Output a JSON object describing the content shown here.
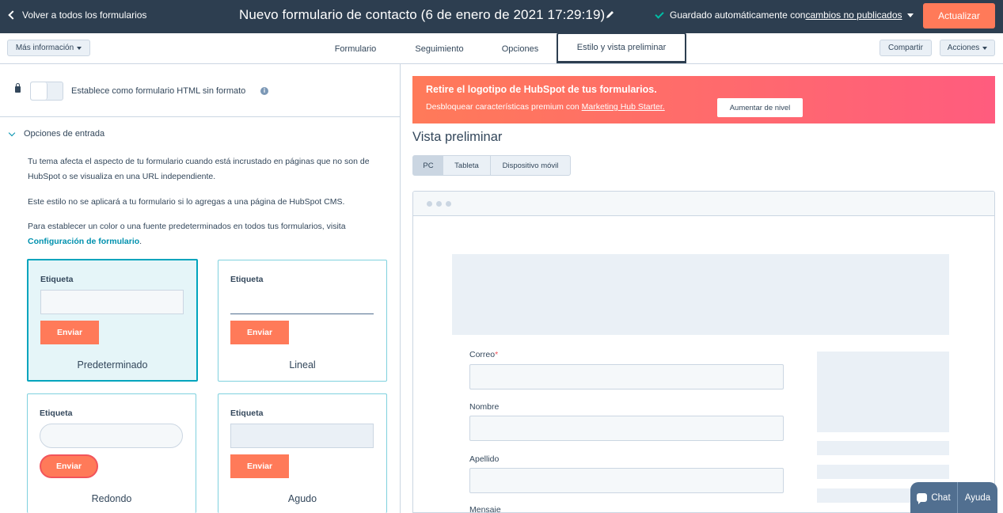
{
  "topbar": {
    "back_label": "Volver a todos los formularios",
    "form_title": "Nuevo formulario de contacto (6 de enero de 2021 17:29:19)",
    "saved_text": "Guardado automáticamente con",
    "saved_link": "cambios no publicados",
    "update_button": "Actualizar"
  },
  "tabbar": {
    "more_info": "Más información",
    "tabs": [
      {
        "label": "Formulario"
      },
      {
        "label": "Seguimiento"
      },
      {
        "label": "Opciones"
      },
      {
        "label": "Estilo y vista preliminar",
        "active": true
      }
    ],
    "share": "Compartir",
    "actions": "Acciones"
  },
  "left": {
    "raw_html_label": "Establece como formulario HTML sin formato",
    "section_title": "Opciones de entrada",
    "para1": "Tu tema afecta el aspecto de tu formulario cuando está incrustado en páginas que no son de HubSpot o se visualiza en una URL independiente.",
    "para2": "Este estilo no se aplicará a tu formulario si lo agregas a una página de HubSpot CMS.",
    "para3": "Para establecer un color o una fuente predeterminados en todos tus formularios, visita",
    "para3_link": "Configuración de formulario",
    "para3_end": ".",
    "styles": [
      {
        "field_label": "Etiqueta",
        "button": "Enviar",
        "name": "Predeterminado",
        "selected": true
      },
      {
        "field_label": "Etiqueta",
        "button": "Enviar",
        "name": "Lineal"
      },
      {
        "field_label": "Etiqueta",
        "button": "Enviar",
        "name": "Redondo"
      },
      {
        "field_label": "Etiqueta",
        "button": "Enviar",
        "name": "Agudo"
      }
    ]
  },
  "right": {
    "banner_title": "Retire el logotipo de HubSpot de tus formularios.",
    "banner_text": "Desbloquear características premium con",
    "banner_link": "Marketing Hub Starter.",
    "banner_button": "Aumentar de nivel",
    "preview_title": "Vista preliminar",
    "devices": [
      "PC",
      "Tableta",
      "Dispositivo móvil"
    ],
    "active_device": "PC",
    "fields": [
      {
        "label": "Correo",
        "required": "*"
      },
      {
        "label": "Nombre"
      },
      {
        "label": "Apellido"
      },
      {
        "label": "Mensaje"
      }
    ]
  },
  "chat": {
    "chat_label": "Chat",
    "help_label": "Ayuda"
  },
  "colors": {
    "topbar": "#2d3e50",
    "accent": "#ff7a59",
    "teal": "#00a4bd",
    "link": "#0091ae"
  }
}
